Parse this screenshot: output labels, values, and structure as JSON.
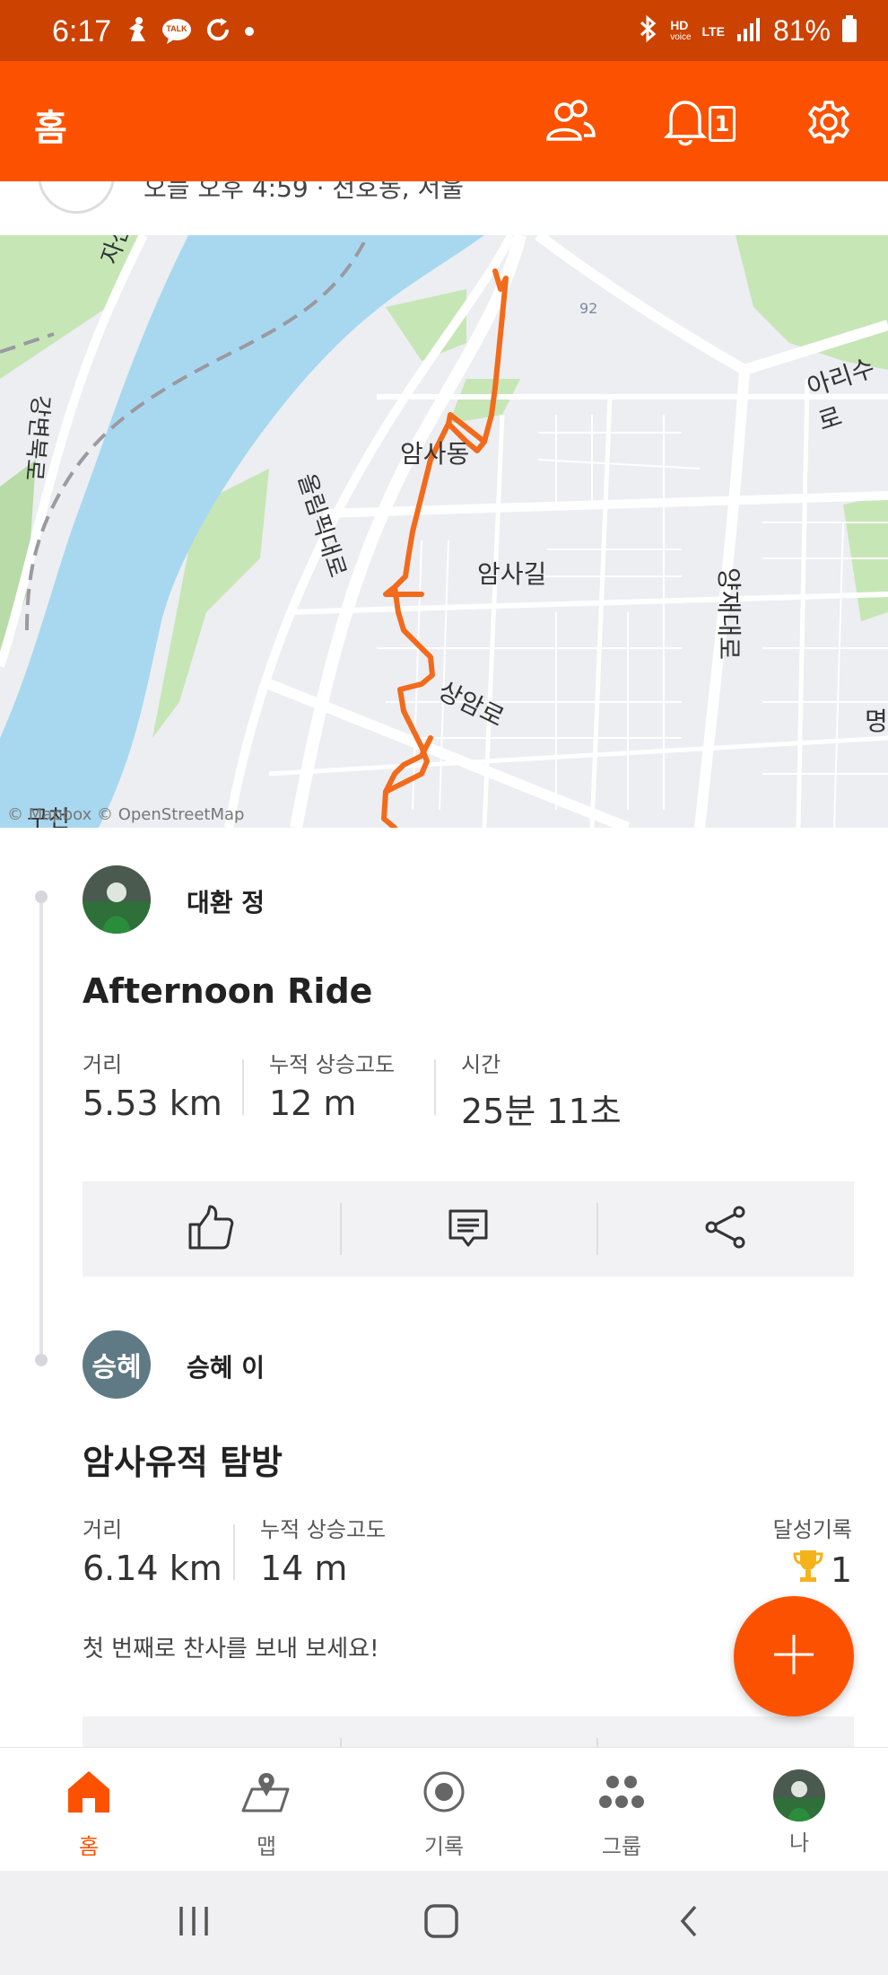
{
  "status_bar": {
    "time": "6:17",
    "talk_label": "TALK",
    "hd_label": "HD",
    "voice_label": "voice",
    "lte_label": "LTE",
    "battery": "81%"
  },
  "app_bar": {
    "title": "홈",
    "notification_count": "1"
  },
  "previous_card": {
    "subtitle": "오늘 오후 4:59 · 천호동, 서울"
  },
  "map": {
    "labels": {
      "amsa_dong": "암사동",
      "olympic_daero": "올림픽대로",
      "amsa_gil": "암사길",
      "sangam_ro": "상암로",
      "yangjae_daero": "양재대로",
      "arisu_ro": "아리수로",
      "gangbyeon": "강변북로",
      "jasan_ro": "자산로",
      "myeong": "명",
      "gucheon": "구천",
      "route_92": "92"
    },
    "attribution": "© Mapbox © OpenStreetMap",
    "route_color": "#f26a1b",
    "water_color": "#a8d8f0",
    "park_color": "#c7e6b6"
  },
  "activities": [
    {
      "athlete": "대환 정",
      "title": "Afternoon Ride",
      "stats": [
        {
          "label": "거리",
          "value": "5.53 km"
        },
        {
          "label": "누적 상승고도",
          "value": "12 m"
        },
        {
          "label": "시간",
          "value": "25분 11초"
        }
      ]
    },
    {
      "athlete": "승혜 이",
      "avatar_initial": "승혜",
      "title": "암사유적 탐방",
      "stats": [
        {
          "label": "거리",
          "value": "6.14 km"
        },
        {
          "label": "누적 상승고도",
          "value": "14 m"
        }
      ],
      "achievements_label": "달성기록",
      "achievements_count": "1",
      "kudos_prompt": "첫 번째로 찬사를 보내 보세요!"
    }
  ],
  "bottom_nav": [
    {
      "label": "홈",
      "icon": "home-icon",
      "active": true
    },
    {
      "label": "맵",
      "icon": "map-icon"
    },
    {
      "label": "기록",
      "icon": "record-icon"
    },
    {
      "label": "그룹",
      "icon": "groups-icon"
    },
    {
      "label": "나",
      "icon": "profile-avatar"
    }
  ],
  "colors": {
    "brand": "#fc5200",
    "status_bar": "#cc4200"
  }
}
